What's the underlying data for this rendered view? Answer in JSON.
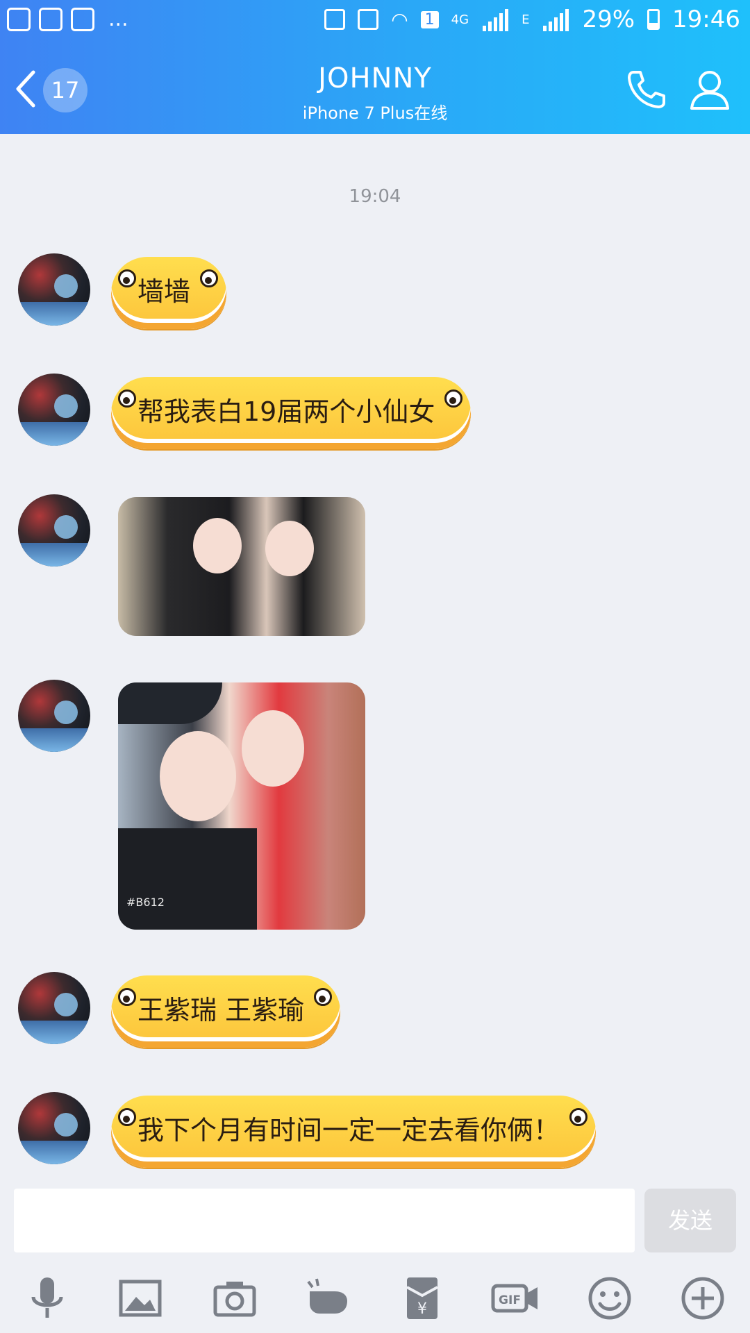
{
  "status_bar": {
    "battery": "29%",
    "time": "19:46",
    "sim": "1",
    "network": "4G",
    "net2": "E"
  },
  "header": {
    "back_count": "17",
    "title": "JOHNNY",
    "subtitle": "iPhone 7 Plus在线"
  },
  "chat": {
    "timestamp": "19:04",
    "messages": [
      {
        "type": "text",
        "text": "墙墙"
      },
      {
        "type": "text",
        "text": "帮我表白19届两个小仙女"
      },
      {
        "type": "image",
        "caption": ""
      },
      {
        "type": "image",
        "caption": "#B612"
      },
      {
        "type": "text",
        "text": "王紫瑞 王紫瑜"
      },
      {
        "type": "text",
        "text": "我下个月有时间一定一定去看你俩！"
      }
    ]
  },
  "composer": {
    "input_value": "",
    "send_label": "发送"
  },
  "toolbar_icons": [
    "microphone-icon",
    "image-icon",
    "camera-icon",
    "shake-icon",
    "red-packet-icon",
    "gif-icon",
    "emoji-icon",
    "plus-icon"
  ],
  "colors": {
    "header_start": "#3f83f3",
    "header_end": "#1fc0fb",
    "bubble": "#fcc33a",
    "background": "#eef0f5"
  }
}
